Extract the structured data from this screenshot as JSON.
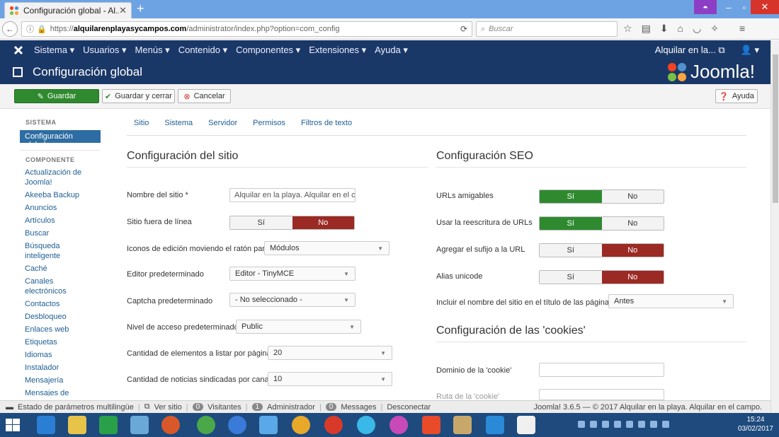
{
  "browser": {
    "tab_title": "Configuración global - Al...",
    "url_prefix": "https://",
    "url_domain": "alquilarenplayasycampos.com",
    "url_path": "/administrator/index.php?option=com_config",
    "search_placeholder": "Buscar"
  },
  "menu": {
    "items": [
      "Sistema ▾",
      "Usuarios ▾",
      "Menús ▾",
      "Contenido ▾",
      "Componentes ▾",
      "Extensiones ▾",
      "Ayuda ▾"
    ],
    "site_link": "Alquilar en la... ⧉",
    "user_menu": "👤 ▾"
  },
  "header": {
    "title": "Configuración global",
    "brand": "Joomla!"
  },
  "toolbar": {
    "save": "Guardar",
    "save_close": "Guardar y cerrar",
    "cancel": "Cancelar",
    "help": "Ayuda"
  },
  "sidebar": {
    "system_heading": "SISTEMA",
    "active_item": "Configuración global",
    "component_heading": "COMPONENTE",
    "items": [
      "Actualización de Joomla!",
      "Akeeba Backup",
      "Anuncios",
      "Artículos",
      "Buscar",
      "Búsqueda inteligente",
      "Caché",
      "Canales electrónicos",
      "Contactos",
      "Desbloqueo",
      "Enlaces web",
      "Etiquetas",
      "Idiomas",
      "Instalador",
      "Mensajería",
      "Mensajes de"
    ]
  },
  "tabs": [
    "Sitio",
    "Sistema",
    "Servidor",
    "Permisos",
    "Filtros de texto"
  ],
  "site_config": {
    "title": "Configuración del sitio",
    "site_name_label": "Nombre del sitio *",
    "site_name_value": "Alquilar en la playa. Alquilar en el campo.",
    "offline_label": "Sitio fuera de línea",
    "edit_icons_label": "Iconos de edición moviendo el ratón para",
    "edit_icons_value": "Módulos",
    "editor_label": "Editor predeterminado",
    "editor_value": "Editor - TinyMCE",
    "captcha_label": "Captcha predeterminado",
    "captcha_value": "- No seleccionado -",
    "access_label": "Nivel de acceso predeterminado",
    "access_value": "Public",
    "list_limit_label": "Cantidad de elementos a listar por página",
    "list_limit_value": "20",
    "feed_limit_label": "Cantidad de noticias sindicadas por canal",
    "feed_limit_value": "10"
  },
  "seo": {
    "title": "Configuración SEO",
    "sef_label": "URLs amigables",
    "rewrite_label": "Usar la reescritura de URLs",
    "suffix_label": "Agregar el sufijo a la URL",
    "unicode_label": "Alias unicode",
    "sitename_label": "Incluir el nombre del sitio en el título de las páginas",
    "sitename_value": "Antes"
  },
  "cookies": {
    "title": "Configuración de las 'cookies'",
    "domain_label": "Dominio de la 'cookie'",
    "path_label": "Ruta de la 'cookie'"
  },
  "toggles": {
    "yes": "Sí",
    "no": "No"
  },
  "status": {
    "multilang": "Estado de parámetros multilingüe",
    "view_site": "Ver sitio",
    "visitors_count": "0",
    "visitors": "Visitantes",
    "admin_count": "1",
    "admin": "Administrador",
    "messages_count": "0",
    "messages": "Messages",
    "logout": "Desconectar",
    "footer": "Joomla! 3.6.5 — © 2017 Alquilar en la playa. Alquilar en el campo."
  },
  "taskbar": {
    "time": "15:24",
    "date": "03/02/2017"
  },
  "colors": {
    "joomla_blue": "#1a3867",
    "save_green": "#2f8a2f",
    "toggle_red": "#9b2a24",
    "link_blue": "#1f5e93"
  }
}
